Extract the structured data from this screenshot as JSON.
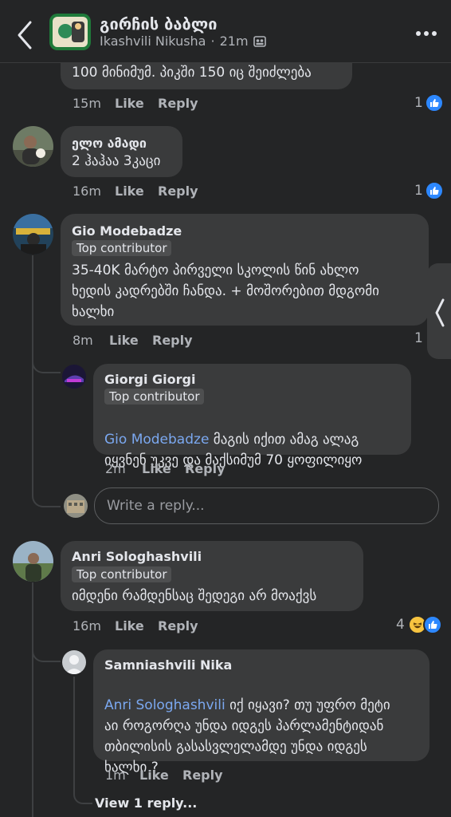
{
  "header": {
    "group_name": "გირჩის ბაბლი",
    "author": "Ikashvili Nikusha",
    "separator": "·",
    "time": "21m"
  },
  "comments": [
    {
      "text": "100 მინიმუმ. პიკში 150 იც შეიძლება",
      "time": "15m",
      "like": "Like",
      "reply": "Reply",
      "reaction_count": "1"
    },
    {
      "name": "ელო ამადი",
      "text": "2 ჰაჰაა 3კაცი",
      "time": "16m",
      "like": "Like",
      "reply": "Reply",
      "reaction_count": "1"
    },
    {
      "name": "Gio Modebadze",
      "badge": "Top contributor",
      "text": "35-40K მარტო პირველი სკოლის წინ ახლო\nხედის კადრებში ჩანდა. + მოშორებით მდგომი\nხალხი",
      "time": "8m",
      "like": "Like",
      "reply": "Reply",
      "reaction_count": "1"
    },
    {
      "name": "Giorgi Giorgi",
      "badge": "Top contributor",
      "mention": "Gio Modebadze",
      "text_line1": " მაგის იქით ამაგ ალაგ",
      "text_line2": "იყვნენ უკვე და მაქსიმუმ 70 ყოფილიყო",
      "time": "2m",
      "like": "Like",
      "reply": "Reply"
    },
    {
      "name": "Anri Sologhashvili",
      "badge": "Top contributor",
      "text": "იმდენი რამდენსაც შედეგი არ მოაქვს",
      "time": "16m",
      "like": "Like",
      "reply": "Reply",
      "reaction_count": "4"
    },
    {
      "name": "Samniashvili Nika",
      "mention": "Anri Sologhashvili",
      "text_line1": " იქ იყავი? თუ უფრო მეტი",
      "text_rest": "აი როგორღა უნდა იდგეს პარლამენტიდან\nთბილისის გასასვლელამდე უნდა იდგეს\nხალხი ?",
      "time": "1m",
      "like": "Like",
      "reply": "Reply"
    }
  ],
  "write_reply_placeholder": "Write a reply...",
  "view_replies": "View 1 reply...",
  "colors": {
    "background": "#242526",
    "bubble": "#3a3b3c",
    "mention": "#7ba8f0",
    "like_blue": "#2d88ff"
  }
}
